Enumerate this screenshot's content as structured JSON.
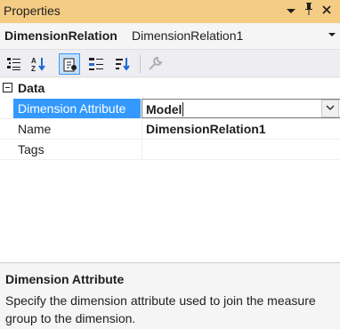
{
  "window": {
    "title": "Properties",
    "colors": {
      "titlebar": "#f5cc84",
      "selection": "#3399ff",
      "toolbar": "#eeeef2"
    }
  },
  "object_selector": {
    "name": "DimensionRelation",
    "type": "DimensionRelation1"
  },
  "toolbar": {
    "buttons": [
      {
        "icon": "categorized-icon",
        "active": false
      },
      {
        "icon": "alphabetical-icon",
        "active": false
      },
      {
        "icon": "properties-page-icon",
        "active": true
      },
      {
        "icon": "events-icon",
        "active": false
      },
      {
        "icon": "sort-icon",
        "active": false
      },
      {
        "icon": "wrench-icon",
        "active": false
      }
    ]
  },
  "grid": {
    "category": "Data",
    "rows": [
      {
        "name": "Dimension Attribute",
        "value": "Model"
      },
      {
        "name": "Name",
        "value": "DimensionRelation1"
      },
      {
        "name": "Tags",
        "value": ""
      }
    ]
  },
  "description": {
    "title": "Dimension Attribute",
    "text": "Specify the dimension attribute used to join the measure group to the dimension."
  }
}
